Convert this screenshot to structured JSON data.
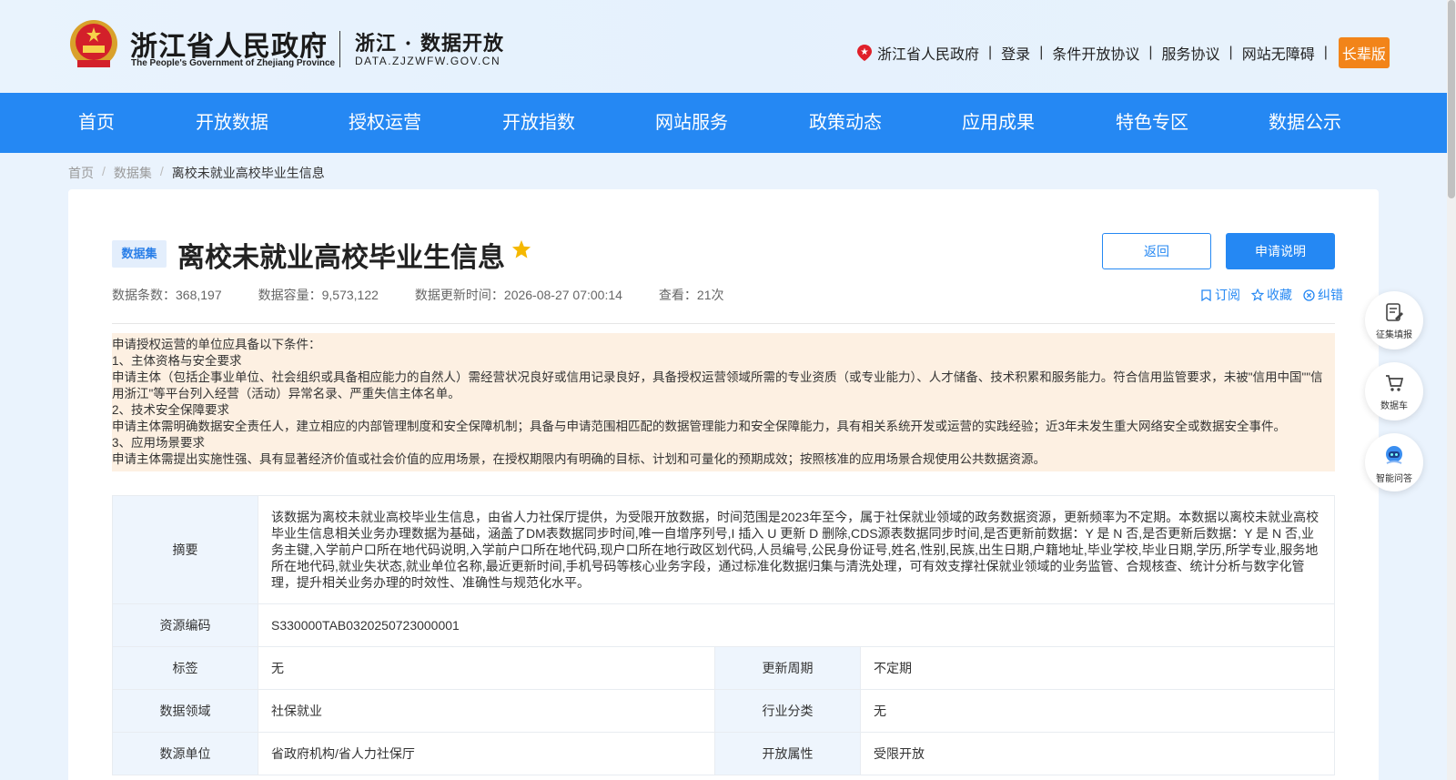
{
  "header": {
    "gov_name_cn": "浙江省人民政府",
    "gov_name_en": "The People's Government of Zhejiang Province",
    "site_name_cn": "浙江 · 数据开放",
    "site_domain": "DATA.ZJZWFW.GOV.CN",
    "links": {
      "gov": "浙江省人民政府",
      "login": "登录",
      "conditional_agreement": "条件开放协议",
      "service_agreement": "服务协议",
      "accessibility": "网站无障碍",
      "elder": "长辈版"
    }
  },
  "nav": [
    "首页",
    "开放数据",
    "授权运营",
    "开放指数",
    "网站服务",
    "政策动态",
    "应用成果",
    "特色专区",
    "数据公示"
  ],
  "breadcrumb": {
    "home": "首页",
    "datasets": "数据集",
    "current": "离校未就业高校毕业生信息"
  },
  "dataset": {
    "badge": "数据集",
    "title": "离校未就业高校毕业生信息",
    "meta": {
      "rows": "数据条数：368,197",
      "capacity": "数据容量：9,573,122",
      "updated": "数据更新时间：2026-08-27 07:00:14",
      "views": "查看：21次"
    },
    "buttons": {
      "back": "返回",
      "apply": "申请说明"
    },
    "actions": {
      "subscribe": "订阅",
      "favorite": "收藏",
      "correct": "纠错"
    }
  },
  "notice": {
    "line1": "申请授权运营的单位应具备以下条件：",
    "line2": "1、主体资格与安全要求",
    "line3": "申请主体（包括企事业单位、社会组织或具备相应能力的自然人）需经营状况良好或信用记录良好，具备授权运营领域所需的专业资质（或专业能力）、人才储备、技术积累和服务能力。符合信用监管要求，未被\"信用中国\"\"信用浙江\"等平台列入经营（活动）异常名录、严重失信主体名单。",
    "line4": "2、技术安全保障要求",
    "line5": "申请主体需明确数据安全责任人，建立相应的内部管理制度和安全保障机制；具备与申请范围相匹配的数据管理能力和安全保障能力，具有相关系统开发或运营的实践经验；近3年未发生重大网络安全或数据安全事件。",
    "line6": "3、应用场景要求",
    "line7": "申请主体需提出实施性强、具有显著经济价值或社会价值的应用场景，在授权期限内有明确的目标、计划和可量化的预期成效；按照核准的应用场景合规使用公共数据资源。"
  },
  "info": {
    "abstract_label": "摘要",
    "abstract": "该数据为离校未就业高校毕业生信息，由省人力社保厅提供，为受限开放数据，时间范围是2023年至今，属于社保就业领域的政务数据资源，更新频率为不定期。本数据以离校未就业高校毕业生信息相关业务办理数据为基础，涵盖了DM表数据同步时间,唯一自增序列号,I 插入 U 更新 D 删除,CDS源表数据同步时间,是否更新前数据：Y 是 N 否,是否更新后数据：Y 是 N 否,业务主键,入学前户口所在地代码说明,入学前户口所在地代码,现户口所在地行政区划代码,人员编号,公民身份证号,姓名,性别,民族,出生日期,户籍地址,毕业学校,毕业日期,学历,所学专业,服务地所在地代码,就业失状态,就业单位名称,最近更新时间,手机号码等核心业务字段，通过标准化数据归集与清洗处理，可有效支撑社保就业领域的业务监管、合规核查、统计分析与数字化管理，提升相关业务办理的时效性、准确性与规范化水平。",
    "code_label": "资源编码",
    "code": "S330000TAB0320250723000001",
    "tag_label": "标签",
    "tag": "无",
    "cycle_label": "更新周期",
    "cycle": "不定期",
    "domain_label": "数据领域",
    "domain": "社保就业",
    "industry_label": "行业分类",
    "industry": "无",
    "source_label": "数源单位",
    "source": "省政府机构/省人力社保厅",
    "open_label": "开放属性",
    "open": "受限开放"
  },
  "float": {
    "collect": "征集填报",
    "cart": "数据车",
    "qa": "智能问答"
  },
  "colors": {
    "brand_blue": "#2588f3",
    "elder_orange": "#f28419",
    "notice_bg": "#fdf0e2",
    "star": "#f5b800"
  }
}
